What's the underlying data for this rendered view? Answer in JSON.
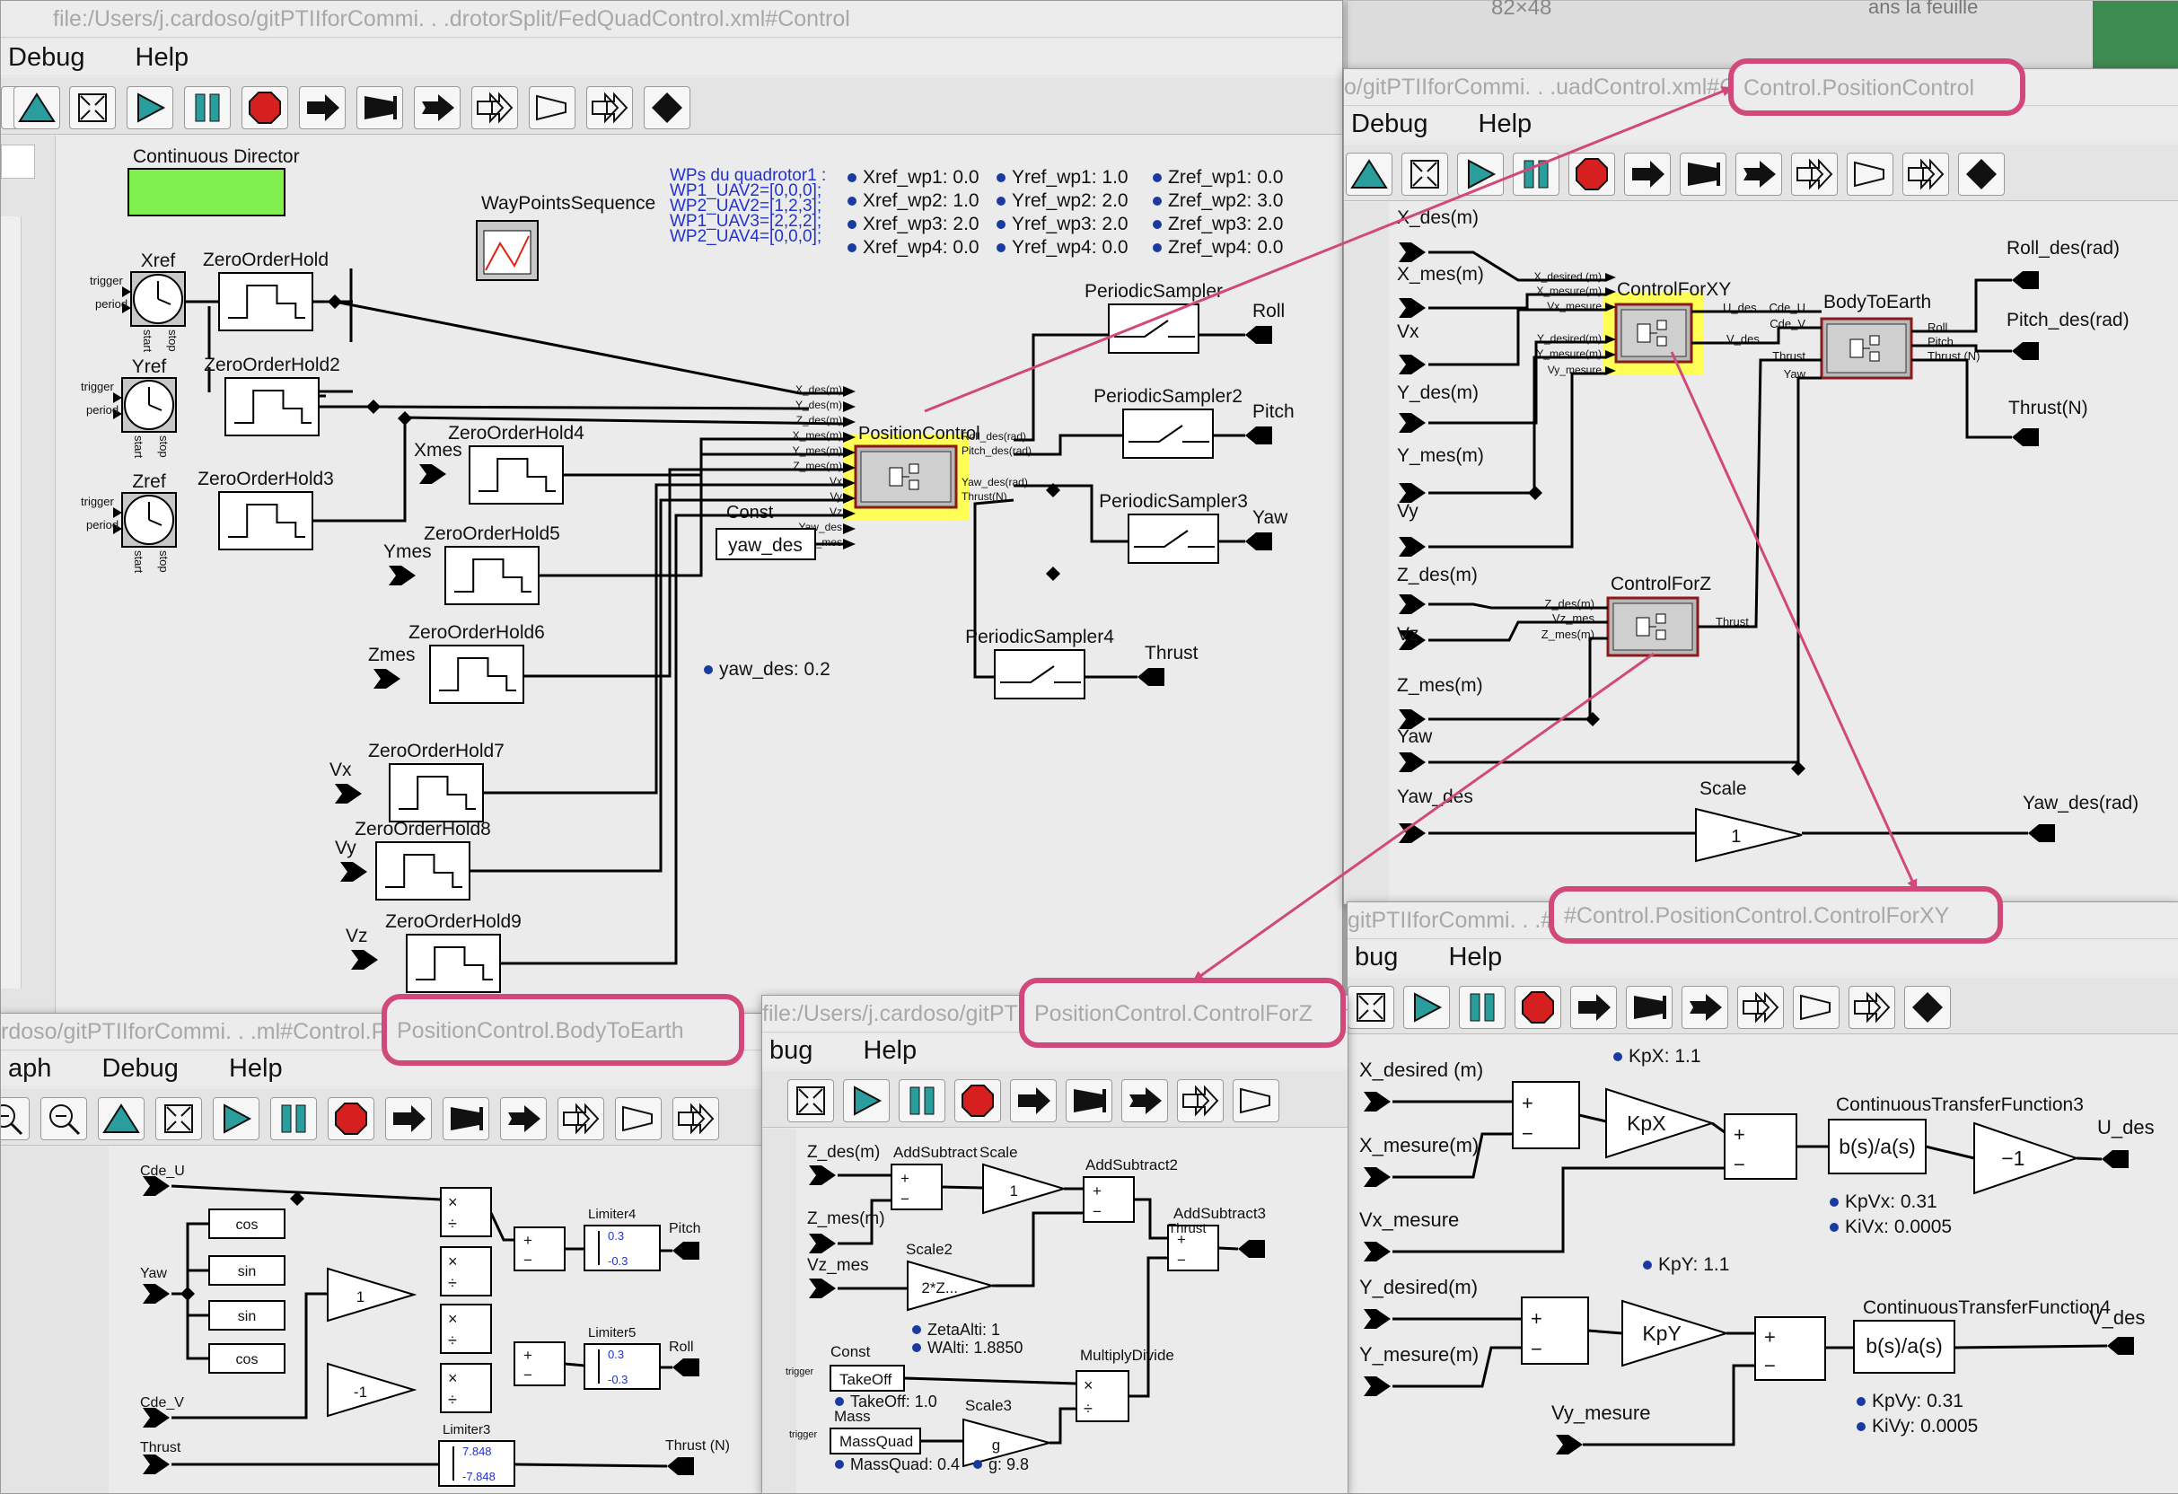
{
  "background": {
    "size_label": "82×48",
    "page_label": "ans la feuille"
  },
  "main_window": {
    "title": "file:/Users/j.cardoso/gitPTIIforCommi. . .drotorSplit/FedQuadControl.xml#Control",
    "menu": [
      "Debug",
      "Help"
    ],
    "director": "Continuous Director",
    "blocks": {
      "xref": "Xref",
      "yref": "Yref",
      "zref": "Zref",
      "zoh": "ZeroOrderHold",
      "zoh2": "ZeroOrderHold2",
      "zoh3": "ZeroOrderHold3",
      "zoh4": "ZeroOrderHold4",
      "zoh5": "ZeroOrderHold5",
      "zoh6": "ZeroOrderHold6",
      "zoh7": "ZeroOrderHold7",
      "zoh8": "ZeroOrderHold8",
      "zoh9": "ZeroOrderHold9",
      "waypoints": "WayPointsSequence",
      "position_control": "PositionControl",
      "const": "Const",
      "const_value": "yaw_des",
      "ps1": "PeriodicSampler",
      "ps2": "PeriodicSampler2",
      "ps3": "PeriodicSampler3",
      "ps4": "PeriodicSampler4"
    },
    "inputs": [
      "Xmes",
      "Ymes",
      "Zmes",
      "Vx",
      "Vy",
      "Vz"
    ],
    "outputs": [
      "Roll",
      "Pitch",
      "Yaw",
      "Thrust"
    ],
    "clock_ports": {
      "trigger": "trigger",
      "period": "period",
      "start": "start",
      "stop": "stop"
    },
    "pc_inputs": [
      "X_des(m)",
      "Y_des(m)",
      "Z_des(m)",
      "X_mes(m)",
      "Y_mes(m)",
      "Z_mes(m)",
      "Vx",
      "Vy",
      "Vz",
      "Yaw_des",
      "Yaw_mes"
    ],
    "pc_outputs": [
      "Roll_des(rad)",
      "Pitch_des(rad)",
      "Yaw_des(rad)",
      "Thrust(N)"
    ],
    "wp_comment": [
      "WPs du quadrotor1 :",
      "WP1_UAV2=[0,0,0];",
      "WP2_UAV2=[1,2,3];",
      "WP1_UAV3=[2,2,2];",
      "WP2_UAV4=[0,0,0];"
    ],
    "params": {
      "xref": [
        "Xref_wp1: 0.0",
        "Xref_wp2: 1.0",
        "Xref_wp3: 2.0",
        "Xref_wp4: 0.0"
      ],
      "yref": [
        "Yref_wp1: 1.0",
        "Yref_wp2: 2.0",
        "Yref_wp3: 2.0",
        "Yref_wp4: 0.0"
      ],
      "zref": [
        "Zref_wp1: 0.0",
        "Zref_wp2: 3.0",
        "Zref_wp3: 2.0",
        "Zref_wp4: 0.0"
      ],
      "yaw_des": "yaw_des: 0.2"
    }
  },
  "pc_window": {
    "title": "o/gitPTIIforCommi. . .uadControl.xml#Control.PositionControl",
    "highlight": "Control.PositionControl",
    "menu": [
      "Debug",
      "Help"
    ],
    "inputs": [
      "X_des(m)",
      "X_mes(m)",
      "Vx",
      "Y_des(m)",
      "Y_mes(m)",
      "Vy",
      "Z_des(m)",
      "Vz",
      "Z_mes(m)",
      "Yaw",
      "Yaw_des"
    ],
    "outputs": [
      "Roll_des(rad)",
      "Pitch_des(rad)",
      "Thrust(N)",
      "Yaw_des(rad)"
    ],
    "blocks": {
      "cfxy": "ControlForXY",
      "b2e": "BodyToEarth",
      "cfz": "ControlForZ",
      "scale": "Scale",
      "scale_val": "1"
    },
    "cfxy_in": [
      "X_desired (m)",
      "X_mesure(m)",
      "Vx_mesure",
      "Y_desired(m)",
      "Y_mesure(m)",
      "Vy_mesure"
    ],
    "cfxy_out": [
      "U_des",
      "V_des"
    ],
    "b2e_in": [
      "Cde_U",
      "Cde_V",
      "Thrust",
      "Yaw"
    ],
    "b2e_out": [
      "Roll",
      "Pitch",
      "Thrust (N)"
    ],
    "cfz_in": [
      "Z_des(m)",
      "Vz_mes",
      "Z_mes(m)"
    ],
    "cfz_out": "Thrust"
  },
  "b2e_window": {
    "title": "rdoso/gitPTIIforCommi. . .ml#Control.PositionControl.BodyToEarth",
    "highlight": "PositionControl.BodyToEarth",
    "menu": [
      "aph",
      "Debug",
      "Help"
    ],
    "labels": {
      "cde_u": "Cde_U",
      "yaw": "Yaw",
      "cde_v": "Cde_V",
      "thrust": "Thrust",
      "pitch": "Pitch",
      "roll": "Roll",
      "thrust_n": "Thrust (N)"
    },
    "funcs": [
      "cos",
      "sin",
      "sin",
      "cos"
    ],
    "gains": [
      "1",
      "-1"
    ],
    "limiters": [
      {
        "name": "Limiter4",
        "hi": "0.3",
        "lo": "-0.3"
      },
      {
        "name": "Limiter5",
        "hi": "0.3",
        "lo": "-0.3"
      },
      {
        "name": "Limiter3",
        "hi": "7.848",
        "lo": "-7.848"
      }
    ],
    "ops": {
      "times": "×",
      "div": "÷",
      "plus": "+",
      "minus": "−"
    }
  },
  "cfz_window": {
    "title": "file:/Users/j.cardoso/gitPTIIforCommi. . .ml#Control.PositionControl.ControlForZ",
    "highlight": "PositionControl.ControlForZ",
    "menu": [
      "bug",
      "Help"
    ],
    "labels": {
      "z_des": "Z_des(m)",
      "z_mes": "Z_mes(m)",
      "vz_mes": "Vz_mes",
      "thrust": "Thrust"
    },
    "blocks": {
      "add1": "AddSubtract",
      "scale": "Scale",
      "add2": "AddSubtract2",
      "add3": "AddSubtract3",
      "scale2": "Scale2",
      "scale2_val": "2*Z...",
      "scale_val": "1",
      "const": "Const",
      "const_val": "TakeOff",
      "mass": "Mass",
      "mass_val": "MassQuad",
      "scale3": "Scale3",
      "scale3_val": "g",
      "md": "MultiplyDivide",
      "trigger": "trigger"
    },
    "params": [
      "ZetaAlti: 1",
      "WAlti: 1.8850",
      "TakeOff: 1.0",
      "MassQuad: 0.4",
      "g: 9.8"
    ]
  },
  "cfxy_window": {
    "title": "gitPTIIforCommi. . .#Control.PositionControl.ControlForXY",
    "highlight": "#Control.PositionControl.ControlForXY",
    "menu": [
      "bug",
      "Help"
    ],
    "labels": {
      "x_des": "X_desired (m)",
      "x_mes": "X_mesure(m)",
      "vx_mes": "Vx_mesure",
      "y_des": "Y_desired(m)",
      "y_mes": "Y_mesure(m)",
      "vy_mes": "Vy_mesure",
      "u_des": "U_des",
      "v_des": "V_des"
    },
    "blocks": {
      "kpx": "KpX",
      "kpy": "KpY",
      "ctf3": "ContinuousTransferFunction3",
      "ctf4": "ContinuousTransferFunction4",
      "tf": "b(s)/a(s)",
      "neg": "−1"
    },
    "params": [
      "KpX: 1.1",
      "KpVx: 0.31",
      "KiVx: 0.0005",
      "KpY: 1.1",
      "KpVy: 0.31",
      "KiVy: 0.0005"
    ]
  },
  "colors": {
    "annotation": "#d0497a",
    "highlight_block": "#ffff55",
    "director": "#80f04e",
    "stop_button": "#d62020"
  }
}
